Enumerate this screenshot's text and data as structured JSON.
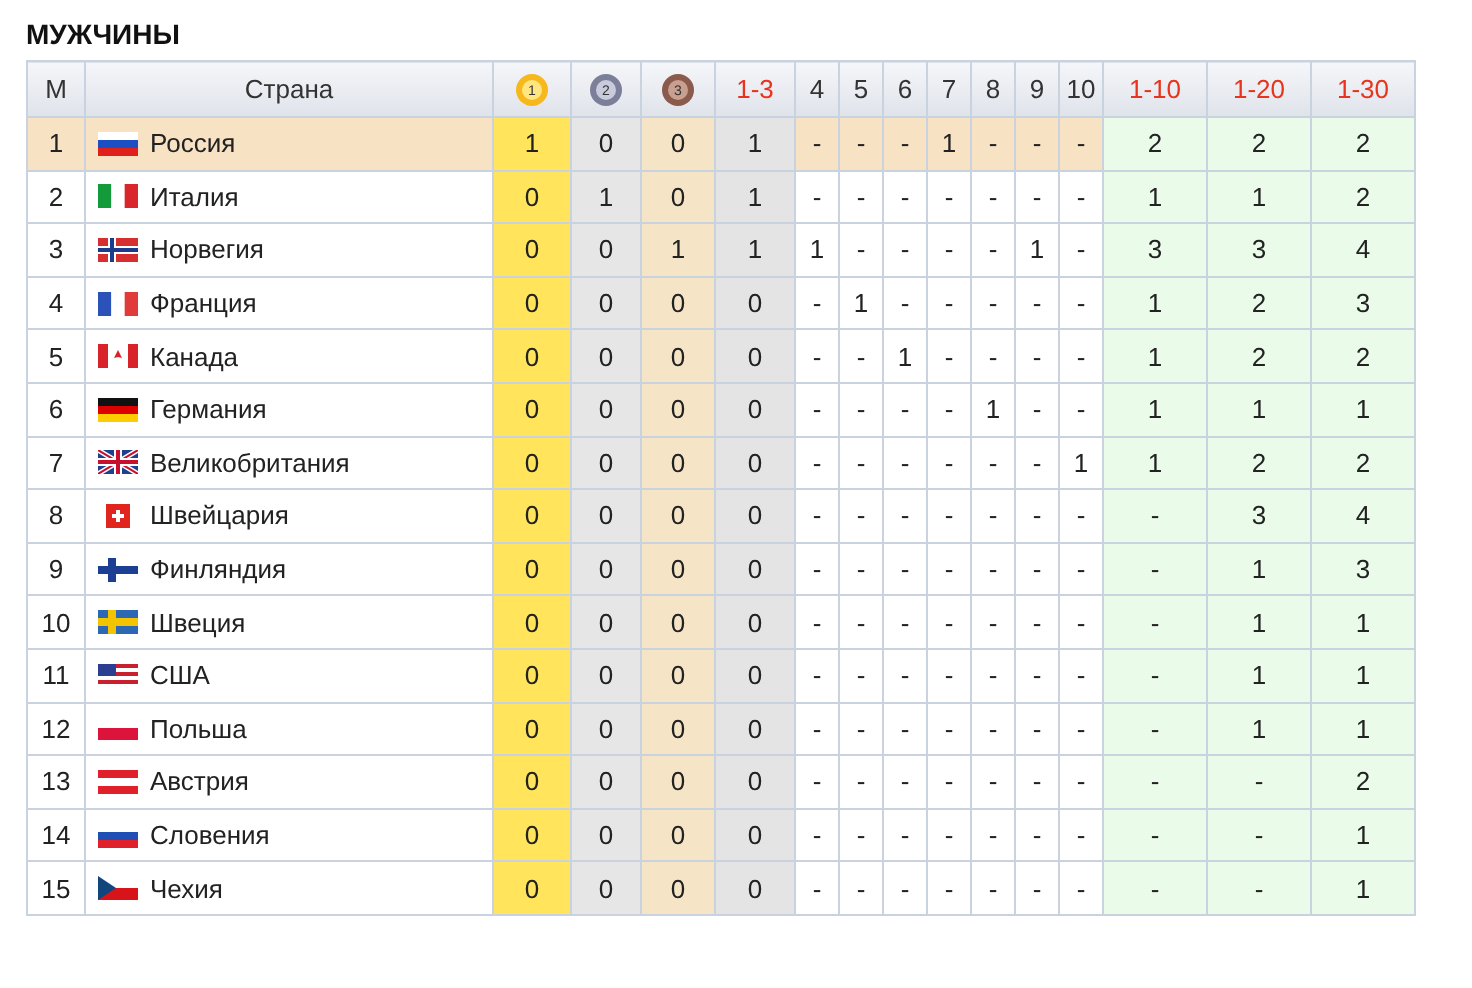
{
  "title": "МУЖЧИНЫ",
  "columns": [
    {
      "label": "М",
      "kind": "place"
    },
    {
      "label": "Страна",
      "kind": "country"
    },
    {
      "label": "1",
      "kind": "gold"
    },
    {
      "label": "2",
      "kind": "silver"
    },
    {
      "label": "3",
      "kind": "bronze"
    },
    {
      "label": "1-3",
      "kind": "podium"
    },
    {
      "label": "4",
      "kind": "position"
    },
    {
      "label": "5",
      "kind": "position"
    },
    {
      "label": "6",
      "kind": "position"
    },
    {
      "label": "7",
      "kind": "position"
    },
    {
      "label": "8",
      "kind": "position"
    },
    {
      "label": "9",
      "kind": "position"
    },
    {
      "label": "10",
      "kind": "position"
    },
    {
      "label": "1-10",
      "kind": "total"
    },
    {
      "label": "1-20",
      "kind": "total"
    },
    {
      "label": "1-30",
      "kind": "total"
    }
  ],
  "rows": [
    {
      "place": "1",
      "country": "Россия",
      "selected": true,
      "values": [
        "1",
        "0",
        "0",
        "1",
        "-",
        "-",
        "-",
        "1",
        "-",
        "-",
        "-",
        "2",
        "2",
        "2"
      ]
    },
    {
      "place": "2",
      "country": "Италия",
      "selected": false,
      "values": [
        "0",
        "1",
        "0",
        "1",
        "-",
        "-",
        "-",
        "-",
        "-",
        "-",
        "-",
        "1",
        "1",
        "2"
      ]
    },
    {
      "place": "3",
      "country": "Норвегия",
      "selected": false,
      "values": [
        "0",
        "0",
        "1",
        "1",
        "1",
        "-",
        "-",
        "-",
        "-",
        "1",
        "-",
        "3",
        "3",
        "4"
      ]
    },
    {
      "place": "4",
      "country": "Франция",
      "selected": false,
      "values": [
        "0",
        "0",
        "0",
        "0",
        "-",
        "1",
        "-",
        "-",
        "-",
        "-",
        "-",
        "1",
        "2",
        "3"
      ]
    },
    {
      "place": "5",
      "country": "Канада",
      "selected": false,
      "values": [
        "0",
        "0",
        "0",
        "0",
        "-",
        "-",
        "1",
        "-",
        "-",
        "-",
        "-",
        "1",
        "2",
        "2"
      ]
    },
    {
      "place": "6",
      "country": "Германия",
      "selected": false,
      "values": [
        "0",
        "0",
        "0",
        "0",
        "-",
        "-",
        "-",
        "-",
        "1",
        "-",
        "-",
        "1",
        "1",
        "1"
      ]
    },
    {
      "place": "7",
      "country": "Великобритания",
      "selected": false,
      "values": [
        "0",
        "0",
        "0",
        "0",
        "-",
        "-",
        "-",
        "-",
        "-",
        "-",
        "1",
        "1",
        "2",
        "2"
      ]
    },
    {
      "place": "8",
      "country": "Швейцария",
      "selected": false,
      "values": [
        "0",
        "0",
        "0",
        "0",
        "-",
        "-",
        "-",
        "-",
        "-",
        "-",
        "-",
        "-",
        "3",
        "4"
      ]
    },
    {
      "place": "9",
      "country": "Финляндия",
      "selected": false,
      "values": [
        "0",
        "0",
        "0",
        "0",
        "-",
        "-",
        "-",
        "-",
        "-",
        "-",
        "-",
        "-",
        "1",
        "3"
      ]
    },
    {
      "place": "10",
      "country": "Швеция",
      "selected": false,
      "values": [
        "0",
        "0",
        "0",
        "0",
        "-",
        "-",
        "-",
        "-",
        "-",
        "-",
        "-",
        "-",
        "1",
        "1"
      ]
    },
    {
      "place": "11",
      "country": "США",
      "selected": false,
      "values": [
        "0",
        "0",
        "0",
        "0",
        "-",
        "-",
        "-",
        "-",
        "-",
        "-",
        "-",
        "-",
        "1",
        "1"
      ]
    },
    {
      "place": "12",
      "country": "Польша",
      "selected": false,
      "values": [
        "0",
        "0",
        "0",
        "0",
        "-",
        "-",
        "-",
        "-",
        "-",
        "-",
        "-",
        "-",
        "1",
        "1"
      ]
    },
    {
      "place": "13",
      "country": "Австрия",
      "selected": false,
      "values": [
        "0",
        "0",
        "0",
        "0",
        "-",
        "-",
        "-",
        "-",
        "-",
        "-",
        "-",
        "-",
        "-",
        "2"
      ]
    },
    {
      "place": "14",
      "country": "Словения",
      "selected": false,
      "values": [
        "0",
        "0",
        "0",
        "0",
        "-",
        "-",
        "-",
        "-",
        "-",
        "-",
        "-",
        "-",
        "-",
        "1"
      ]
    },
    {
      "place": "15",
      "country": "Чехия",
      "selected": false,
      "values": [
        "0",
        "0",
        "0",
        "0",
        "-",
        "-",
        "-",
        "-",
        "-",
        "-",
        "-",
        "-",
        "-",
        "1"
      ]
    }
  ]
}
